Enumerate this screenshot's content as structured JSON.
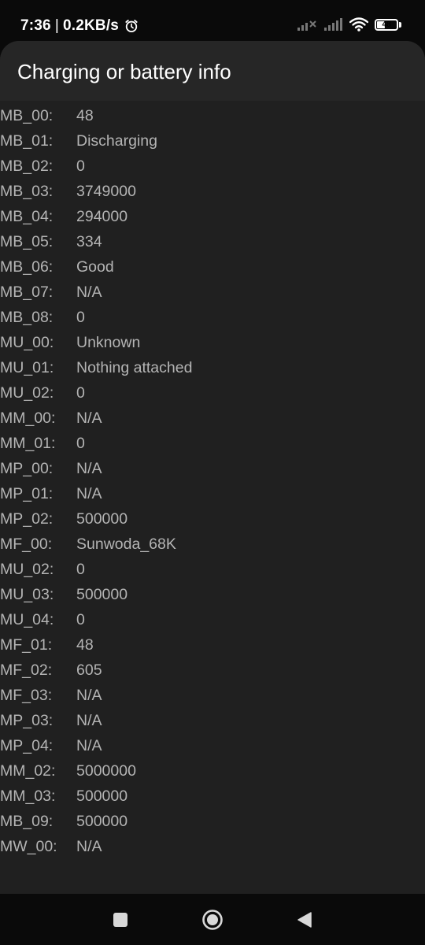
{
  "status_bar": {
    "time": "7:36",
    "separator": "|",
    "net_speed": "0.2KB/s",
    "battery_level": "48",
    "battery_fraction": 0.48
  },
  "dialog": {
    "title": "Charging or battery info",
    "rows": [
      {
        "key": "MB_00:",
        "value": "48"
      },
      {
        "key": "MB_01:",
        "value": "Discharging"
      },
      {
        "key": "MB_02:",
        "value": "0"
      },
      {
        "key": "MB_03:",
        "value": "3749000"
      },
      {
        "key": "MB_04:",
        "value": "294000"
      },
      {
        "key": "MB_05:",
        "value": "334"
      },
      {
        "key": "MB_06:",
        "value": "Good"
      },
      {
        "key": "MB_07:",
        "value": "N/A"
      },
      {
        "key": "MB_08:",
        "value": "0"
      },
      {
        "key": "MU_00:",
        "value": "Unknown"
      },
      {
        "key": "MU_01:",
        "value": "Nothing attached"
      },
      {
        "key": "MU_02:",
        "value": "0"
      },
      {
        "key": "MM_00:",
        "value": "N/A"
      },
      {
        "key": "MM_01:",
        "value": "0"
      },
      {
        "key": "MP_00:",
        "value": "N/A"
      },
      {
        "key": "MP_01:",
        "value": "N/A"
      },
      {
        "key": "MP_02:",
        "value": "500000"
      },
      {
        "key": "MF_00:",
        "value": "Sunwoda_68K"
      },
      {
        "key": "MU_02:",
        "value": "0"
      },
      {
        "key": "MU_03:",
        "value": "500000"
      },
      {
        "key": "MU_04:",
        "value": "0"
      },
      {
        "key": "MF_01:",
        "value": "48"
      },
      {
        "key": "MF_02:",
        "value": "605"
      },
      {
        "key": "MF_03:",
        "value": "N/A"
      },
      {
        "key": "MP_03:",
        "value": "N/A"
      },
      {
        "key": "MP_04:",
        "value": "N/A"
      },
      {
        "key": "MM_02:",
        "value": "5000000"
      },
      {
        "key": "MM_03:",
        "value": "500000"
      },
      {
        "key": "MB_09:",
        "value": "500000"
      },
      {
        "key": "MW_00:",
        "value": "N/A"
      }
    ]
  },
  "nav_bar": {
    "icons": [
      "recents-square-icon",
      "home-circle-icon",
      "back-triangle-icon"
    ]
  }
}
